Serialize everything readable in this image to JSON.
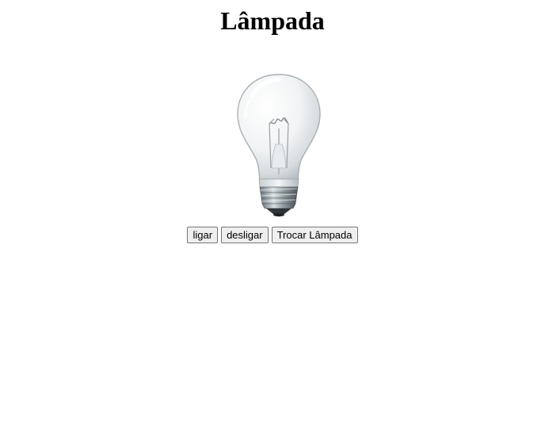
{
  "page": {
    "title": "Lâmpada"
  },
  "lamp": {
    "state": "off",
    "icon": "lightbulb-icon"
  },
  "buttons": {
    "on_label": "ligar",
    "off_label": "desligar",
    "swap_label": "Trocar Lâmpada"
  }
}
